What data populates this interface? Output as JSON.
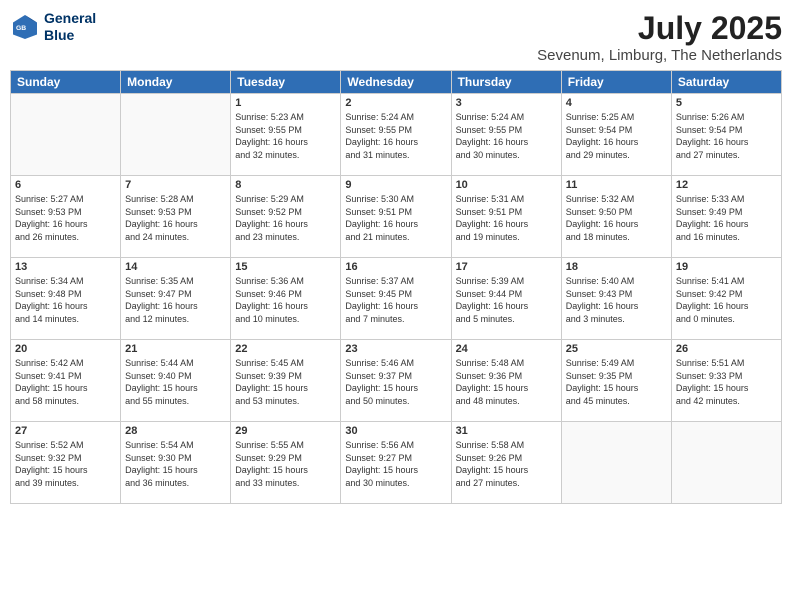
{
  "header": {
    "logo_line1": "General",
    "logo_line2": "Blue",
    "month": "July 2025",
    "location": "Sevenum, Limburg, The Netherlands"
  },
  "weekdays": [
    "Sunday",
    "Monday",
    "Tuesday",
    "Wednesday",
    "Thursday",
    "Friday",
    "Saturday"
  ],
  "weeks": [
    [
      {
        "day": "",
        "info": ""
      },
      {
        "day": "",
        "info": ""
      },
      {
        "day": "1",
        "info": "Sunrise: 5:23 AM\nSunset: 9:55 PM\nDaylight: 16 hours\nand 32 minutes."
      },
      {
        "day": "2",
        "info": "Sunrise: 5:24 AM\nSunset: 9:55 PM\nDaylight: 16 hours\nand 31 minutes."
      },
      {
        "day": "3",
        "info": "Sunrise: 5:24 AM\nSunset: 9:55 PM\nDaylight: 16 hours\nand 30 minutes."
      },
      {
        "day": "4",
        "info": "Sunrise: 5:25 AM\nSunset: 9:54 PM\nDaylight: 16 hours\nand 29 minutes."
      },
      {
        "day": "5",
        "info": "Sunrise: 5:26 AM\nSunset: 9:54 PM\nDaylight: 16 hours\nand 27 minutes."
      }
    ],
    [
      {
        "day": "6",
        "info": "Sunrise: 5:27 AM\nSunset: 9:53 PM\nDaylight: 16 hours\nand 26 minutes."
      },
      {
        "day": "7",
        "info": "Sunrise: 5:28 AM\nSunset: 9:53 PM\nDaylight: 16 hours\nand 24 minutes."
      },
      {
        "day": "8",
        "info": "Sunrise: 5:29 AM\nSunset: 9:52 PM\nDaylight: 16 hours\nand 23 minutes."
      },
      {
        "day": "9",
        "info": "Sunrise: 5:30 AM\nSunset: 9:51 PM\nDaylight: 16 hours\nand 21 minutes."
      },
      {
        "day": "10",
        "info": "Sunrise: 5:31 AM\nSunset: 9:51 PM\nDaylight: 16 hours\nand 19 minutes."
      },
      {
        "day": "11",
        "info": "Sunrise: 5:32 AM\nSunset: 9:50 PM\nDaylight: 16 hours\nand 18 minutes."
      },
      {
        "day": "12",
        "info": "Sunrise: 5:33 AM\nSunset: 9:49 PM\nDaylight: 16 hours\nand 16 minutes."
      }
    ],
    [
      {
        "day": "13",
        "info": "Sunrise: 5:34 AM\nSunset: 9:48 PM\nDaylight: 16 hours\nand 14 minutes."
      },
      {
        "day": "14",
        "info": "Sunrise: 5:35 AM\nSunset: 9:47 PM\nDaylight: 16 hours\nand 12 minutes."
      },
      {
        "day": "15",
        "info": "Sunrise: 5:36 AM\nSunset: 9:46 PM\nDaylight: 16 hours\nand 10 minutes."
      },
      {
        "day": "16",
        "info": "Sunrise: 5:37 AM\nSunset: 9:45 PM\nDaylight: 16 hours\nand 7 minutes."
      },
      {
        "day": "17",
        "info": "Sunrise: 5:39 AM\nSunset: 9:44 PM\nDaylight: 16 hours\nand 5 minutes."
      },
      {
        "day": "18",
        "info": "Sunrise: 5:40 AM\nSunset: 9:43 PM\nDaylight: 16 hours\nand 3 minutes."
      },
      {
        "day": "19",
        "info": "Sunrise: 5:41 AM\nSunset: 9:42 PM\nDaylight: 16 hours\nand 0 minutes."
      }
    ],
    [
      {
        "day": "20",
        "info": "Sunrise: 5:42 AM\nSunset: 9:41 PM\nDaylight: 15 hours\nand 58 minutes."
      },
      {
        "day": "21",
        "info": "Sunrise: 5:44 AM\nSunset: 9:40 PM\nDaylight: 15 hours\nand 55 minutes."
      },
      {
        "day": "22",
        "info": "Sunrise: 5:45 AM\nSunset: 9:39 PM\nDaylight: 15 hours\nand 53 minutes."
      },
      {
        "day": "23",
        "info": "Sunrise: 5:46 AM\nSunset: 9:37 PM\nDaylight: 15 hours\nand 50 minutes."
      },
      {
        "day": "24",
        "info": "Sunrise: 5:48 AM\nSunset: 9:36 PM\nDaylight: 15 hours\nand 48 minutes."
      },
      {
        "day": "25",
        "info": "Sunrise: 5:49 AM\nSunset: 9:35 PM\nDaylight: 15 hours\nand 45 minutes."
      },
      {
        "day": "26",
        "info": "Sunrise: 5:51 AM\nSunset: 9:33 PM\nDaylight: 15 hours\nand 42 minutes."
      }
    ],
    [
      {
        "day": "27",
        "info": "Sunrise: 5:52 AM\nSunset: 9:32 PM\nDaylight: 15 hours\nand 39 minutes."
      },
      {
        "day": "28",
        "info": "Sunrise: 5:54 AM\nSunset: 9:30 PM\nDaylight: 15 hours\nand 36 minutes."
      },
      {
        "day": "29",
        "info": "Sunrise: 5:55 AM\nSunset: 9:29 PM\nDaylight: 15 hours\nand 33 minutes."
      },
      {
        "day": "30",
        "info": "Sunrise: 5:56 AM\nSunset: 9:27 PM\nDaylight: 15 hours\nand 30 minutes."
      },
      {
        "day": "31",
        "info": "Sunrise: 5:58 AM\nSunset: 9:26 PM\nDaylight: 15 hours\nand 27 minutes."
      },
      {
        "day": "",
        "info": ""
      },
      {
        "day": "",
        "info": ""
      }
    ]
  ]
}
